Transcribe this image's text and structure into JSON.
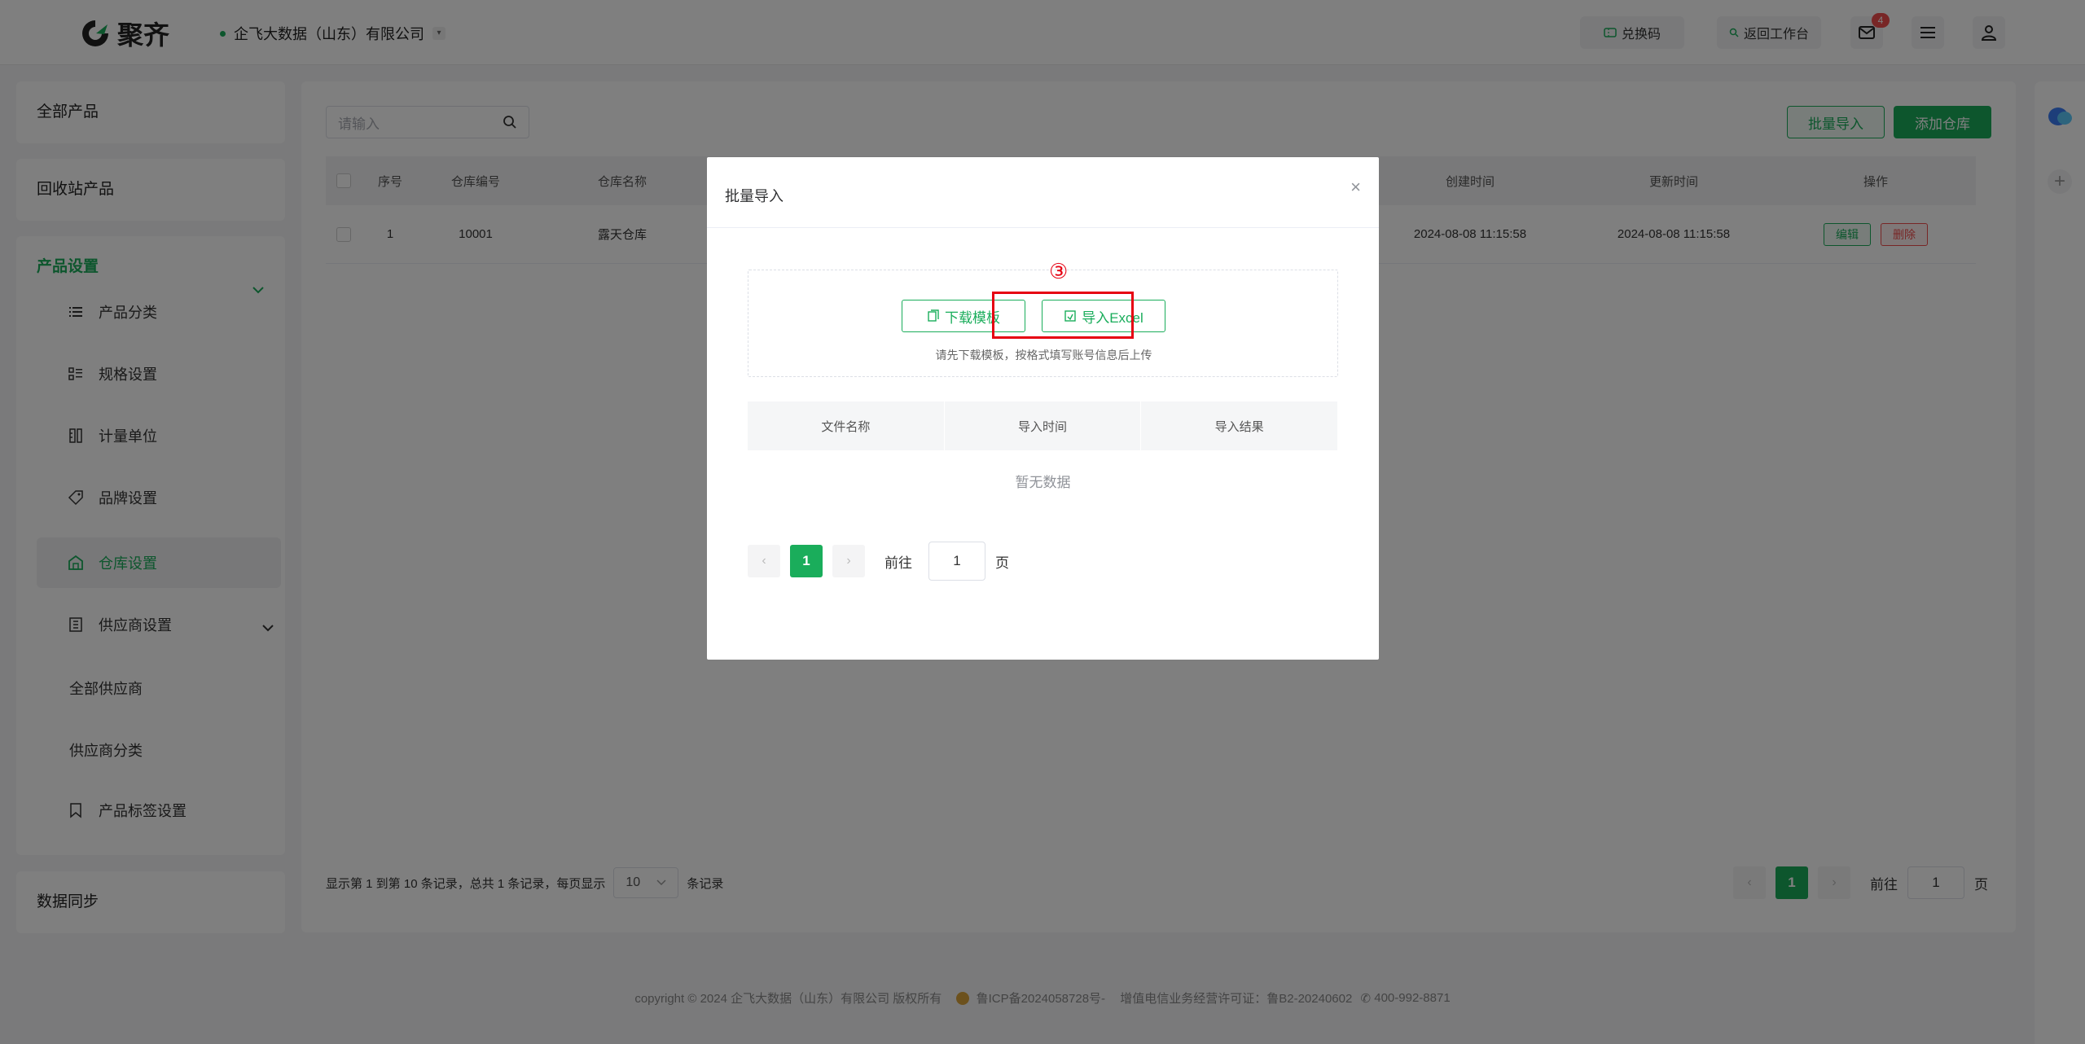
{
  "header": {
    "logo_text": "聚齐",
    "company": "企飞大数据（山东）有限公司",
    "redeem_label": "兑换码",
    "workspace_label": "返回工作台",
    "mail_badge": "4"
  },
  "sidebar": {
    "all_products": "全部产品",
    "recycle_products": "回收站产品",
    "product_settings": "产品设置",
    "items": [
      {
        "label": "产品分类"
      },
      {
        "label": "规格设置"
      },
      {
        "label": "计量单位"
      },
      {
        "label": "品牌设置"
      },
      {
        "label": "仓库设置"
      },
      {
        "label": "供应商设置"
      },
      {
        "label": "产品标签设置"
      }
    ],
    "supplier_sub": [
      "全部供应商",
      "供应商分类"
    ],
    "data_sync": "数据同步"
  },
  "main": {
    "search_placeholder": "请输入",
    "batch_import": "批量导入",
    "add_warehouse": "添加仓库",
    "columns": [
      "序号",
      "仓库编号",
      "仓库名称",
      "创建时间",
      "更新时间",
      "操作"
    ],
    "row": {
      "index": "1",
      "code": "10001",
      "name": "露天仓库",
      "created": "2024-08-08 11:15:58",
      "updated": "2024-08-08 11:15:58",
      "edit": "编辑",
      "delete": "删除"
    },
    "footer_text": "显示第 1 到第 10 条记录，总共 1 条记录，每页显示",
    "page_size": "10",
    "records_suffix": "条记录",
    "page_current": "1",
    "goto_label": "前往",
    "goto_value": "1",
    "page_suffix": "页"
  },
  "modal": {
    "title": "批量导入",
    "download_template": "下载模板",
    "import_excel": "导入Excel",
    "step_marker": "③",
    "hint": "请先下载模板，按格式填写账号信息后上传",
    "columns": [
      "文件名称",
      "导入时间",
      "导入结果"
    ],
    "empty": "暂无数据",
    "page_current": "1",
    "goto_label": "前往",
    "goto_value": "1",
    "page_suffix": "页"
  },
  "footer": {
    "copyright": "copyright © 2024 企飞大数据（山东）有限公司 版权所有",
    "icp": "鲁ICP备2024058728号-",
    "license": "增值电信业务经营许可证：鲁B2-20240602",
    "phone": "400-992-8871"
  },
  "colors": {
    "accent": "#1aad5b",
    "danger": "#f04c4c",
    "highlight": "#e60012"
  }
}
